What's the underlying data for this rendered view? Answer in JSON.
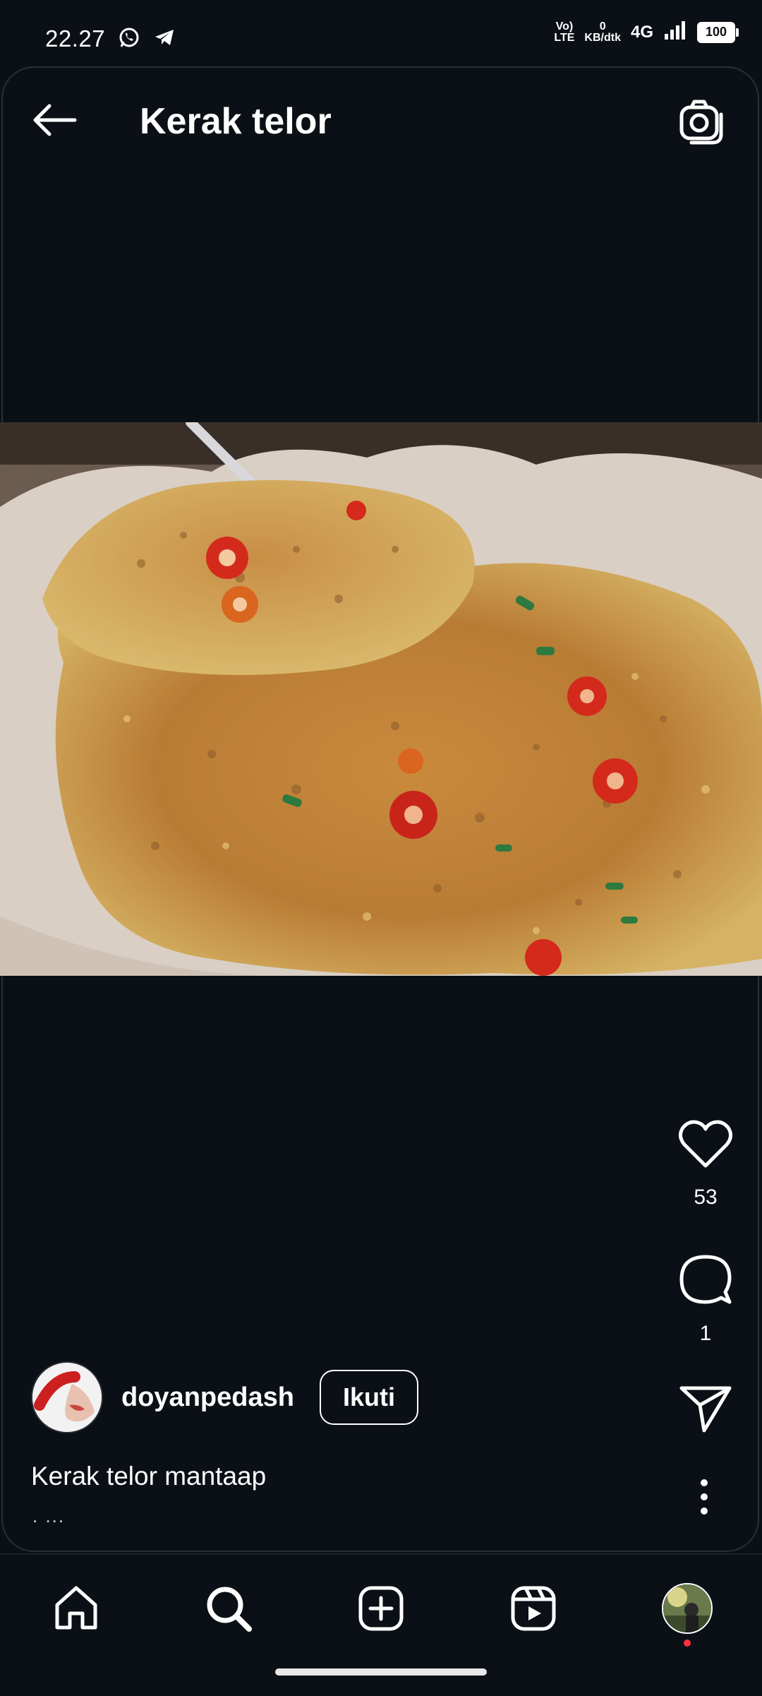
{
  "status_bar": {
    "time": "22.27",
    "net_top": "Vo)",
    "net_bottom": "LTE",
    "speed_value": "0",
    "speed_unit": "KB/dtk",
    "network": "4G",
    "battery": "100",
    "icons": [
      "whatsapp-icon",
      "telegram-icon",
      "signal-icon"
    ]
  },
  "header": {
    "title": "Kerak telor",
    "back_icon": "arrow-left-icon",
    "camera_icon": "camera-icon"
  },
  "post": {
    "image_description_icon": "photo",
    "likes": "53",
    "comments": "1",
    "author": "doyanpedash",
    "follow_label": "Ikuti",
    "caption": "Kerak telor mantaap",
    "caption_more": ". ..."
  },
  "colors": {
    "background": "#0b0f16",
    "text": "#ffffff",
    "notification_dot": "#ff3040"
  },
  "bottom_nav": {
    "items": [
      "home-icon",
      "search-icon",
      "add-icon",
      "reels-icon",
      "profile-avatar"
    ]
  }
}
